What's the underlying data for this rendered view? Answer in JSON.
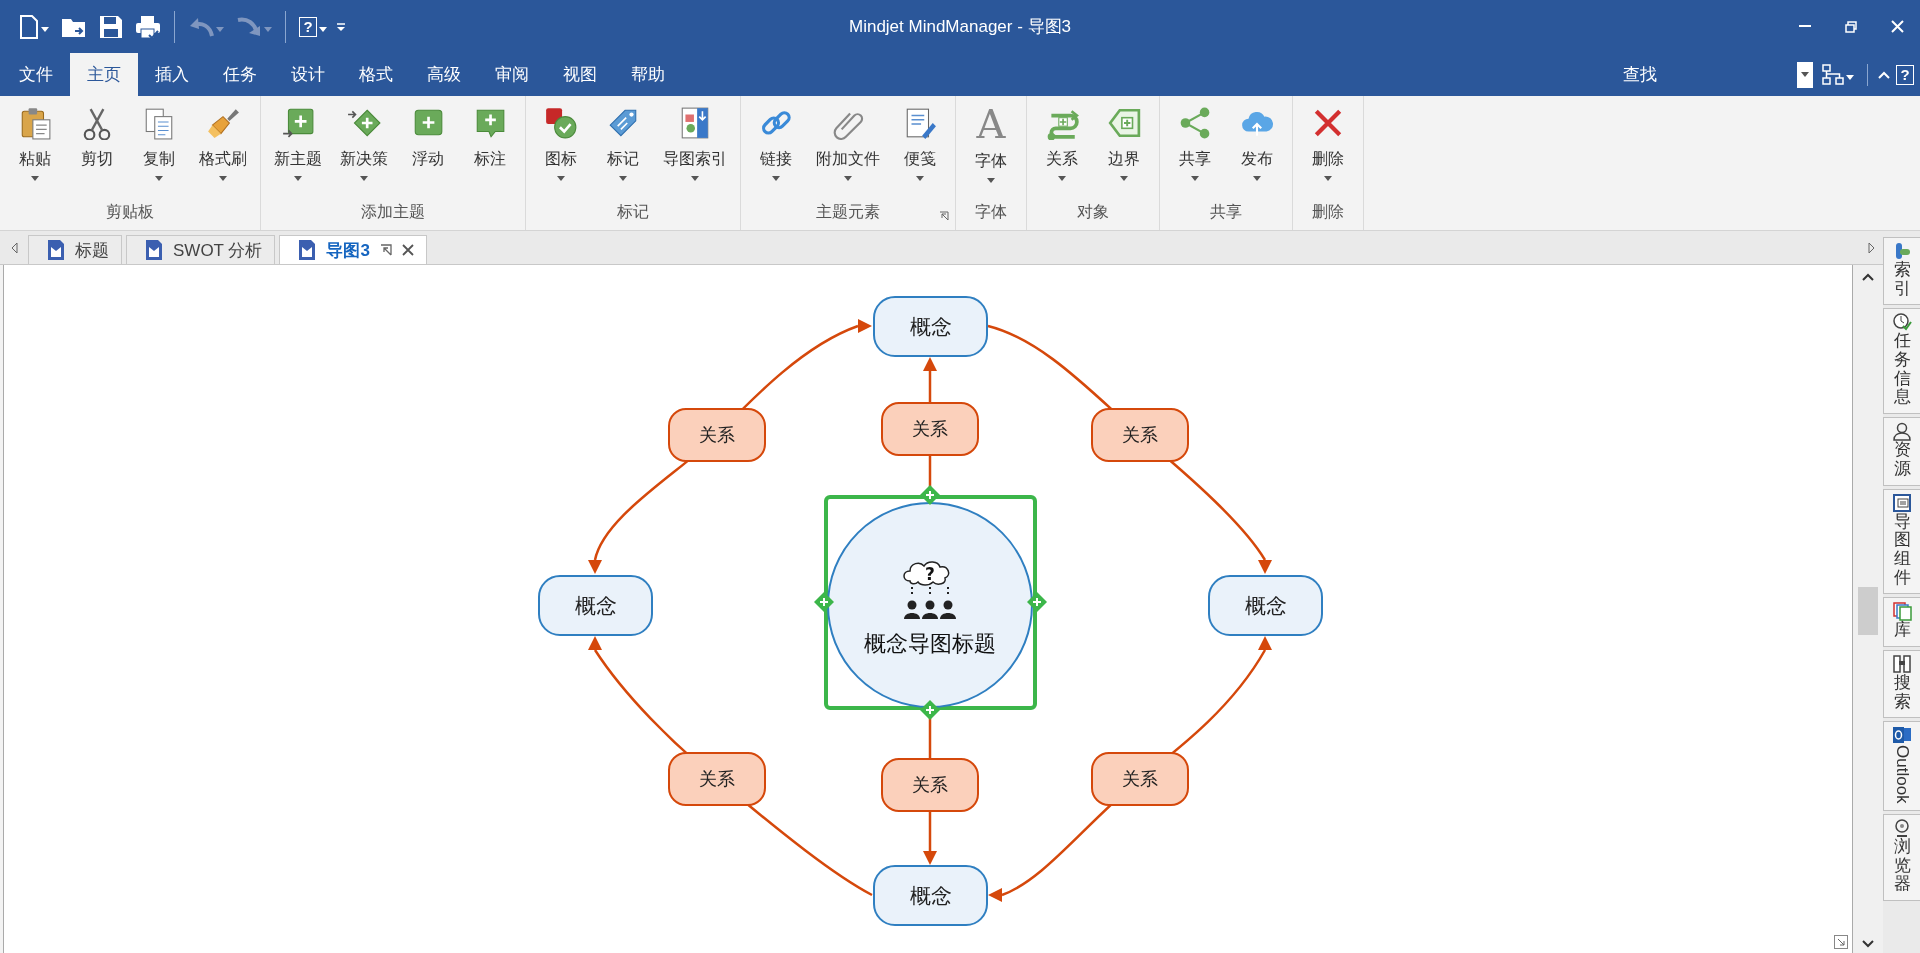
{
  "window": {
    "title": "Mindjet MindManager - 导图3"
  },
  "quick_access": {
    "help_glyph": "?"
  },
  "menu_tabs": [
    {
      "label": "文件",
      "selected": false
    },
    {
      "label": "主页",
      "selected": true
    },
    {
      "label": "插入",
      "selected": false
    },
    {
      "label": "任务",
      "selected": false
    },
    {
      "label": "设计",
      "selected": false
    },
    {
      "label": "格式",
      "selected": false
    },
    {
      "label": "高级",
      "selected": false
    },
    {
      "label": "审阅",
      "selected": false
    },
    {
      "label": "视图",
      "selected": false
    },
    {
      "label": "帮助",
      "selected": false
    }
  ],
  "search": {
    "label": "查找"
  },
  "help": {
    "glyph": "?"
  },
  "ribbon_groups": [
    {
      "label": "剪贴板",
      "launcher": false,
      "buttons": [
        {
          "label": "粘贴",
          "dropdown": true
        },
        {
          "label": "剪切",
          "dropdown": false
        },
        {
          "label": "复制",
          "dropdown": true
        },
        {
          "label": "格式刷",
          "dropdown": true
        }
      ]
    },
    {
      "label": "添加主题",
      "launcher": false,
      "buttons": [
        {
          "label": "新主题",
          "dropdown": true
        },
        {
          "label": "新决策",
          "dropdown": true
        },
        {
          "label": "浮动",
          "dropdown": false
        },
        {
          "label": "标注",
          "dropdown": false
        }
      ]
    },
    {
      "label": "标记",
      "launcher": false,
      "buttons": [
        {
          "label": "图标",
          "dropdown": true
        },
        {
          "label": "标记",
          "dropdown": true
        },
        {
          "label": "导图索引",
          "dropdown": true
        }
      ]
    },
    {
      "label": "主题元素",
      "launcher": true,
      "buttons": [
        {
          "label": "链接",
          "dropdown": true
        },
        {
          "label": "附加文件",
          "dropdown": true
        },
        {
          "label": "便笺",
          "dropdown": true
        }
      ]
    },
    {
      "label": "字体",
      "launcher": false,
      "buttons": [
        {
          "label": "字体",
          "dropdown": true,
          "icon_glyph": "A"
        }
      ]
    },
    {
      "label": "对象",
      "launcher": false,
      "buttons": [
        {
          "label": "关系",
          "dropdown": true
        },
        {
          "label": "边界",
          "dropdown": true
        }
      ]
    },
    {
      "label": "共享",
      "launcher": false,
      "buttons": [
        {
          "label": "共享",
          "dropdown": true
        },
        {
          "label": "发布",
          "dropdown": true
        }
      ]
    },
    {
      "label": "删除",
      "launcher": false,
      "buttons": [
        {
          "label": "删除",
          "dropdown": true
        }
      ]
    }
  ],
  "doc_tabs": [
    {
      "label": "标题",
      "selected": false
    },
    {
      "label": "SWOT 分析",
      "selected": false
    },
    {
      "label": "导图3",
      "selected": true
    }
  ],
  "map": {
    "central_topic": {
      "text": "概念导图标题",
      "icon_glyph": "?",
      "selected": true
    },
    "concepts": [
      {
        "text": "概念"
      },
      {
        "text": "概念"
      },
      {
        "text": "概念"
      },
      {
        "text": "概念"
      }
    ],
    "relations": [
      {
        "text": "关系"
      },
      {
        "text": "关系"
      },
      {
        "text": "关系"
      },
      {
        "text": "关系"
      },
      {
        "text": "关系"
      },
      {
        "text": "关系"
      }
    ]
  },
  "side_panel": [
    {
      "label": "索引",
      "kind": "stacked"
    },
    {
      "label": "任务信息",
      "kind": "stacked"
    },
    {
      "label": "资源",
      "kind": "stacked"
    },
    {
      "label": "导图组件",
      "kind": "stacked"
    },
    {
      "label": "库",
      "kind": "stacked"
    },
    {
      "label": "搜索",
      "kind": "stacked"
    },
    {
      "label": "Outlook",
      "kind": "rotated"
    },
    {
      "label": "浏览器",
      "kind": "stacked"
    }
  ]
}
